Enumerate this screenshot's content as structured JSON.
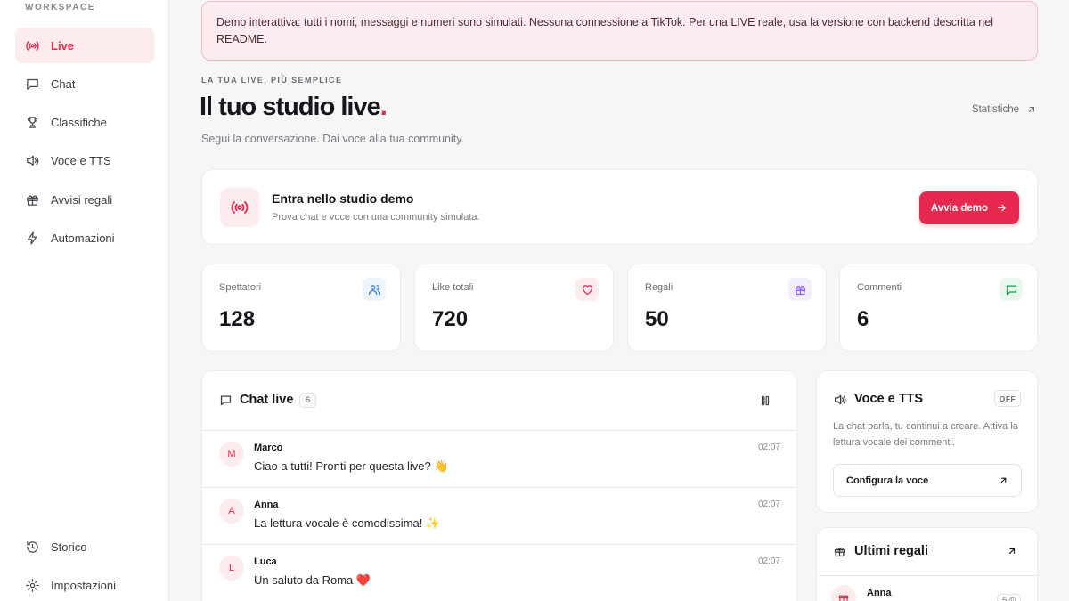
{
  "sidebar": {
    "section_label": "WORKSPACE",
    "items": [
      {
        "label": "Live",
        "icon": "broadcast-icon",
        "active": true
      },
      {
        "label": "Chat",
        "icon": "chat-icon"
      },
      {
        "label": "Classifiche",
        "icon": "trophy-icon"
      },
      {
        "label": "Voce e TTS",
        "icon": "speaker-icon"
      },
      {
        "label": "Avvisi regali",
        "icon": "gift-icon"
      },
      {
        "label": "Automazioni",
        "icon": "lightning-icon"
      }
    ],
    "bottom_items": [
      {
        "label": "Storico",
        "icon": "history-icon"
      },
      {
        "label": "Impostazioni",
        "icon": "gear-icon"
      }
    ]
  },
  "banner": {
    "text": "Demo interattiva: tutti i nomi, messaggi e numeri sono simulati. Nessuna connessione a TikTok. Per una LIVE reale, usa la versione con backend descritta nel README."
  },
  "header": {
    "eyebrow": "LA TUA LIVE, PIÙ SEMPLICE",
    "title": "Il tuo studio live",
    "title_dot": ".",
    "subtitle": "Segui la conversazione. Dai voce alla tua community.",
    "stats_link": "Statistiche"
  },
  "demo": {
    "title": "Entra nello studio demo",
    "subtitle": "Prova chat e voce con una community simulata.",
    "button": "Avvia demo"
  },
  "stats": [
    {
      "label": "Spettatori",
      "value": "128",
      "icon": "users-icon",
      "color": "#3b82c4",
      "bg": "#eef4fb"
    },
    {
      "label": "Like totali",
      "value": "720",
      "icon": "heart-icon",
      "color": "#e5284d",
      "bg": "#fdecee"
    },
    {
      "label": "Regali",
      "value": "50",
      "icon": "gift-icon",
      "color": "#8b5cf6",
      "bg": "#f3eefe"
    },
    {
      "label": "Commenti",
      "value": "6",
      "icon": "chat-icon",
      "color": "#16a34a",
      "bg": "#eaf7ef"
    }
  ],
  "chat": {
    "title": "Chat live",
    "count": "6",
    "messages": [
      {
        "initial": "M",
        "name": "Marco",
        "text": "Ciao a tutti! Pronti per questa live? 👋",
        "time": "02:07"
      },
      {
        "initial": "A",
        "name": "Anna",
        "text": "La lettura vocale è comodissima! ✨",
        "time": "02:07"
      },
      {
        "initial": "L",
        "name": "Luca",
        "text": "Un saluto da Roma ❤️",
        "time": "02:07"
      }
    ]
  },
  "tts": {
    "title": "Voce e TTS",
    "status": "OFF",
    "description": "La chat parla, tu continui a creare. Attiva la lettura vocale dei commenti.",
    "button": "Configura la voce"
  },
  "gifts": {
    "title": "Ultimi regali",
    "items": [
      {
        "name": "Anna",
        "amount": "5 ©"
      }
    ]
  },
  "colors": {
    "accent": "#e5284d",
    "accent_soft": "#fdecee"
  }
}
